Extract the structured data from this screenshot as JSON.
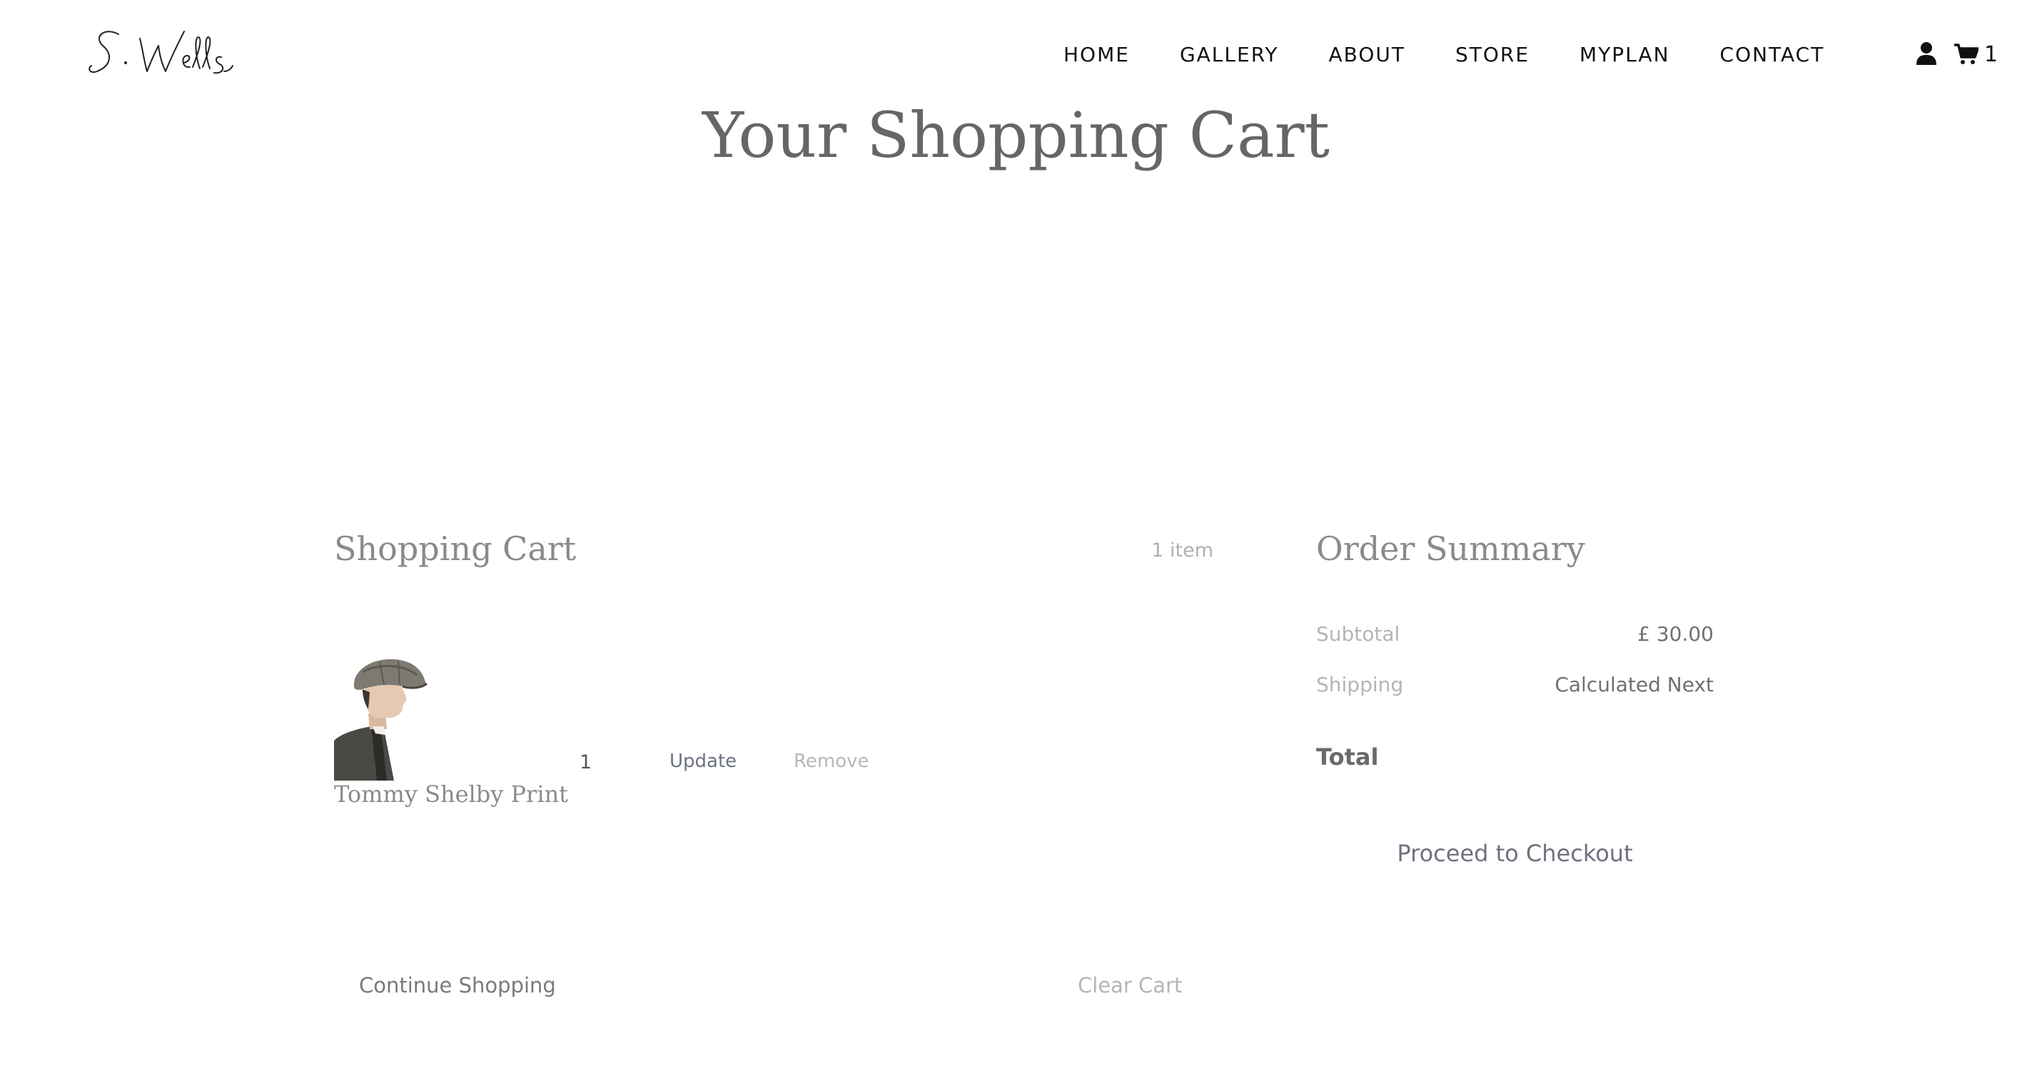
{
  "header": {
    "logo_text": "S. Wells",
    "nav": [
      {
        "label": "HOME"
      },
      {
        "label": "GALLERY"
      },
      {
        "label": "ABOUT"
      },
      {
        "label": "STORE"
      },
      {
        "label": "MYPLAN"
      },
      {
        "label": "CONTACT"
      }
    ],
    "account_icon": "user-icon",
    "cart_icon": "shopping-cart-icon",
    "cart_count": "1"
  },
  "page_title": "Your Shopping Cart",
  "cart": {
    "heading": "Shopping Cart",
    "item_count": "1 item",
    "items": [
      {
        "name": "Tommy Shelby Print",
        "image_icon": "product-portrait-image",
        "quantity": "1",
        "update_label": "Update",
        "remove_label": "Remove"
      }
    ],
    "continue_label": "Continue Shopping",
    "clear_label": "Clear Cart"
  },
  "summary": {
    "heading": "Order Summary",
    "subtotal_label": "Subtotal",
    "subtotal_value": "£ 30.00",
    "shipping_label": "Shipping",
    "shipping_value": "Calculated Next",
    "total_label": "Total",
    "checkout_label": "Proceed to Checkout"
  },
  "colors": {
    "nav_text": "#111111",
    "title_text": "#666666",
    "muted_text": "#b5b5b5",
    "link_text": "#6d7280"
  }
}
